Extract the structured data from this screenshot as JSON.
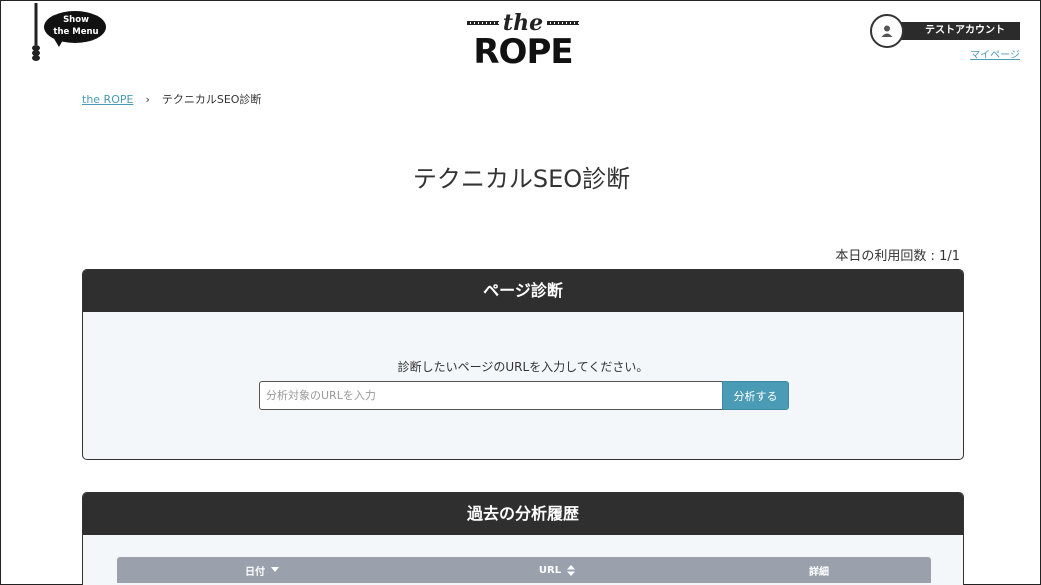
{
  "header": {
    "menu_line1": "Show",
    "menu_line2": "the Menu",
    "logo_the": "the",
    "logo_rope": "ROPE",
    "account_name": "テストアカウント",
    "mypage_label": "マイページ"
  },
  "breadcrumb": {
    "home": "the ROPE",
    "separator": "›",
    "current": "テクニカルSEO診断"
  },
  "page": {
    "title": "テクニカルSEO診断",
    "usage": "本日の利用回数 : 1/1"
  },
  "diagnosis": {
    "header": "ページ診断",
    "instruction": "診断したいページのURLを入力してください。",
    "url_placeholder": "分析対象のURLを入力",
    "url_value": "",
    "submit_label": "分析する"
  },
  "history": {
    "header": "過去の分析履歴",
    "columns": [
      {
        "label": "日付",
        "sort": "desc"
      },
      {
        "label": "URL",
        "sort": "both"
      },
      {
        "label": "詳細",
        "sort": "none"
      }
    ]
  },
  "colors": {
    "accent": "#4a9bb5",
    "panel_header": "#2f2f2f",
    "table_header": "#9aa1ad"
  }
}
